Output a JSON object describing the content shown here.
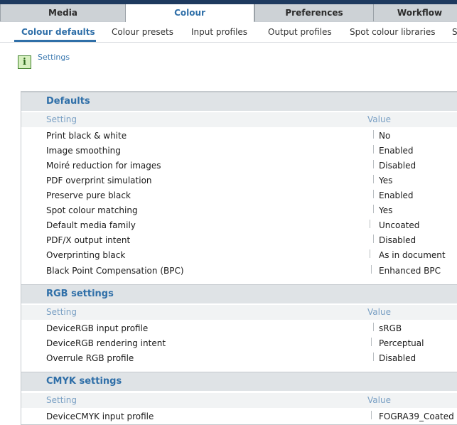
{
  "tabs": [
    "Media",
    "Colour",
    "Preferences",
    "Workflow"
  ],
  "subtabs": [
    "Colour defaults",
    "Colour presets",
    "Input profiles",
    "Output profiles",
    "Spot colour libraries",
    "S"
  ],
  "breadcrumb": "Settings",
  "info_icon_glyph": "i",
  "columns": {
    "setting": "Setting",
    "value": "Value"
  },
  "sections": [
    {
      "title": "Defaults",
      "rows": [
        {
          "label": "Print black & white",
          "value": "No"
        },
        {
          "label": "Image smoothing",
          "value": "Enabled"
        },
        {
          "label": "Moiré reduction for images",
          "value": "Disabled"
        },
        {
          "label": "PDF overprint simulation",
          "value": "Yes"
        },
        {
          "label": "Preserve pure black",
          "value": "Enabled"
        },
        {
          "label": "Spot colour matching",
          "value": "Yes"
        },
        {
          "label": "Default media family",
          "value": "Uncoated"
        },
        {
          "label": "PDF/X output intent",
          "value": "Disabled"
        },
        {
          "label": "Overprinting black",
          "value": "As in document"
        },
        {
          "label": "Black Point Compensation (BPC)",
          "value": "Enhanced BPC"
        }
      ]
    },
    {
      "title": "RGB settings",
      "rows": [
        {
          "label": "DeviceRGB input profile",
          "value": "sRGB"
        },
        {
          "label": "DeviceRGB rendering intent",
          "value": "Perceptual"
        },
        {
          "label": "Overrule RGB profile",
          "value": "Disabled"
        }
      ]
    },
    {
      "title": "CMYK settings",
      "rows": [
        {
          "label": "DeviceCMYK input profile",
          "value": "FOGRA39_Coated"
        }
      ]
    }
  ]
}
